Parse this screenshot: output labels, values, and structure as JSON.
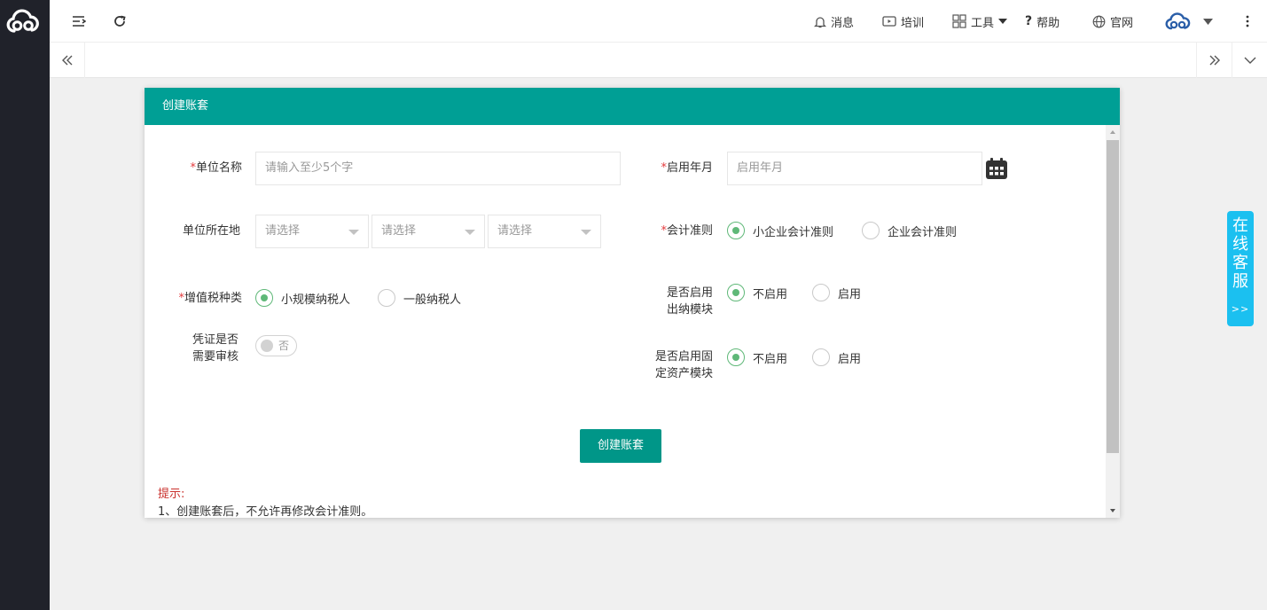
{
  "topbar": {
    "messages": "消息",
    "training": "培训",
    "tools": "工具",
    "help": "帮助",
    "website": "官网"
  },
  "dialog": {
    "title": "创建账套",
    "unit_name": {
      "label": "单位名称",
      "placeholder": "请输入至少5个字"
    },
    "start_month": {
      "label": "启用年月",
      "placeholder": "启用年月"
    },
    "location": {
      "label": "单位所在地",
      "selects": [
        "请选择",
        "请选择",
        "请选择"
      ]
    },
    "accounting_standard": {
      "label": "会计准则",
      "options": [
        "小企业会计准则",
        "企业会计准则"
      ],
      "selected": 0
    },
    "vat_type": {
      "label": "增值税种类",
      "options": [
        "小规模纳税人",
        "一般纳税人"
      ],
      "selected": 0
    },
    "cashier_module": {
      "label": "是否启用出纳模块",
      "options": [
        "不启用",
        "启用"
      ],
      "selected": 0
    },
    "voucher_audit": {
      "label": "凭证是否需要审核",
      "switch_text": "否",
      "enabled": false
    },
    "fixed_asset_module": {
      "label": "是否启用固定资产模块",
      "options": [
        "不启用",
        "启用"
      ],
      "selected": 0
    },
    "create_button": "创建账套",
    "tips_title": "提示:",
    "tips": [
      "1、创建账套后，不允许再修改会计准则。"
    ]
  },
  "service": {
    "text": "在线客服",
    "arrow": ">>"
  },
  "colors": {
    "sidebar": "#20222a",
    "header": "#009f95",
    "button": "#009688",
    "radio": "#5fb878",
    "service": "#1bc0f0",
    "required": "#e4393c"
  }
}
